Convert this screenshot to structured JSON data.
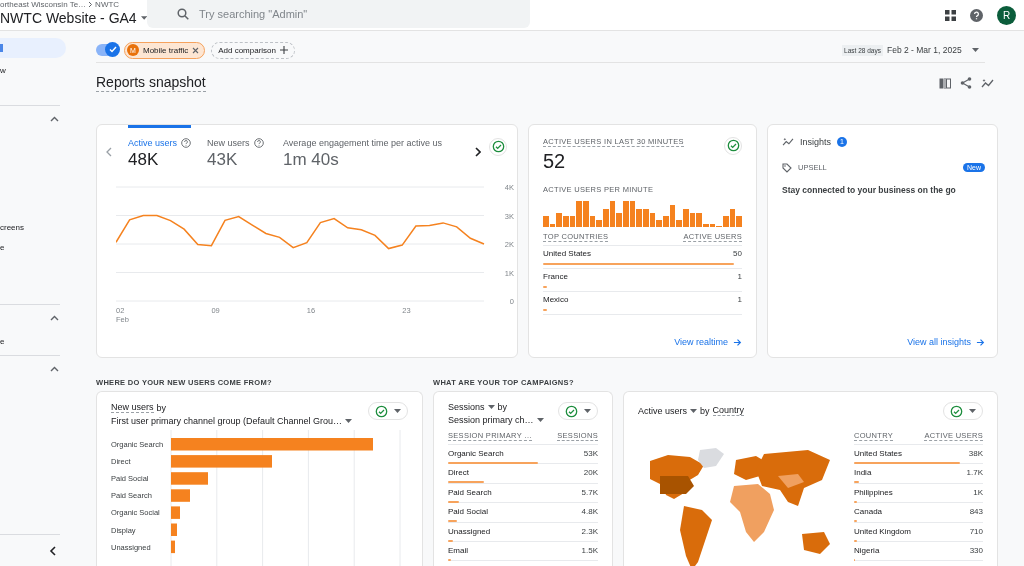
{
  "topbar": {
    "breadcrumb": [
      "ortheast Wisconsin Te…",
      "NWTC"
    ],
    "property": "NWTC Website - GA4",
    "search": {
      "placeholder": "Try searching \"Admin\""
    },
    "avatar": "R"
  },
  "sidebar": {
    "nav": [
      {
        "selected": true
      },
      {
        "label": "w",
        "selected": false
      }
    ],
    "sections": [
      {
        "expanded": true,
        "items": [
          {
            "label": "creens",
            "selected": false
          },
          {
            "label": "e",
            "selected": false
          }
        ]
      },
      {
        "expanded": true,
        "items": [
          {
            "label": "e",
            "selected": false
          }
        ]
      },
      {
        "expanded": true
      }
    ]
  },
  "comparison": {
    "toggle_on": true,
    "chip": {
      "letter": "M",
      "label": "Mobile traffic"
    },
    "add_label": "Add comparison",
    "range_label": "Last 28 days",
    "date_range": "Feb 2 - Mar 1, 2025"
  },
  "title": "Reports snapshot",
  "overview": {
    "metrics": [
      {
        "label": "Active users",
        "value": "48K",
        "help": true,
        "selected": true
      },
      {
        "label": "New users",
        "value": "43K",
        "help": true,
        "selected": false
      },
      {
        "label": "Average engagement time per active us",
        "value": "1m 40s",
        "help": false,
        "selected": false
      }
    ],
    "chart_data": {
      "type": "line",
      "grid": true,
      "categories": [
        "02 Feb",
        null,
        null,
        null,
        null,
        null,
        null,
        "09",
        null,
        null,
        null,
        null,
        null,
        null,
        "16",
        null,
        null,
        null,
        null,
        null,
        null,
        "23",
        null,
        null,
        null,
        null,
        null,
        null
      ],
      "ylim": [
        0,
        4000
      ],
      "yticks": [
        {
          "value": 0,
          "label": "0"
        },
        {
          "value": 1000,
          "label": "1K"
        },
        {
          "value": 2000,
          "label": "2K"
        },
        {
          "value": 3000,
          "label": "3K"
        },
        {
          "value": 4000,
          "label": "4K"
        }
      ],
      "series": [
        {
          "color": "#f5821f",
          "values": [
            2060,
            2850,
            3000,
            3000,
            2820,
            2520,
            1980,
            1940,
            2830,
            2960,
            2660,
            2370,
            2230,
            1870,
            2050,
            2750,
            2890,
            2570,
            2500,
            2300,
            1840,
            1960,
            2630,
            2650,
            2740,
            2600,
            2200,
            2000
          ]
        }
      ]
    }
  },
  "realtime": {
    "title": "ACTIVE USERS IN LAST 30 MINUTES",
    "value": "52",
    "per_minute_label": "ACTIVE USERS PER MINUTE",
    "columns": [
      "TOP COUNTRIES",
      "ACTIVE USERS"
    ],
    "rows": [
      {
        "name": "United States",
        "value": "50",
        "level": 0.96
      },
      {
        "name": "France",
        "value": "1",
        "level": 0.02
      },
      {
        "name": "Mexico",
        "value": "1",
        "level": 0.02
      }
    ],
    "link": "View realtime"
  },
  "insights": {
    "title": "Insights",
    "count": "1",
    "tag": "UPSELL",
    "badge": "New",
    "text": "Stay connected to your business on the go",
    "link": "View all insights"
  },
  "sections": [
    "WHERE DO YOUR NEW USERS COME FROM?",
    "WHAT ARE YOUR TOP CAMPAIGNS?"
  ],
  "new_users": {
    "metric": "New users",
    "by": "by",
    "dimension": "First user primary channel group (Default Channel Grou…",
    "channels": [
      "Organic Search",
      "Direct",
      "Paid Social",
      "Paid Search",
      "Organic Social",
      "Display",
      "Unassigned"
    ]
  },
  "campaigns": {
    "metric": "Sessions",
    "by": "by",
    "dimension": "Session primary ch…",
    "columns": [
      "SESSION PRIMARY …",
      "SESSIONS"
    ],
    "rows": [
      {
        "name": "Organic Search",
        "value": "53K",
        "level": 0.6
      },
      {
        "name": "Direct",
        "value": "20K",
        "level": 0.24
      },
      {
        "name": "Paid Search",
        "value": "5.7K",
        "level": 0.07
      },
      {
        "name": "Paid Social",
        "value": "4.8K",
        "level": 0.06
      },
      {
        "name": "Unassigned",
        "value": "2.3K",
        "level": 0.03
      },
      {
        "name": "Email",
        "value": "1.5K",
        "level": 0.02
      }
    ]
  },
  "countries": {
    "metric": "Active users",
    "by": "by",
    "dimension": "Country",
    "columns": [
      "COUNTRY",
      "ACTIVE USERS"
    ],
    "rows": [
      {
        "name": "United States",
        "value": "38K",
        "level": 0.82
      },
      {
        "name": "India",
        "value": "1.7K",
        "level": 0.04
      },
      {
        "name": "Philippines",
        "value": "1K",
        "level": 0.02
      },
      {
        "name": "Canada",
        "value": "843",
        "level": 0.02
      },
      {
        "name": "United Kingdom",
        "value": "710",
        "level": 0.02
      },
      {
        "name": "Nigeria",
        "value": "330",
        "level": 0.01
      }
    ]
  }
}
